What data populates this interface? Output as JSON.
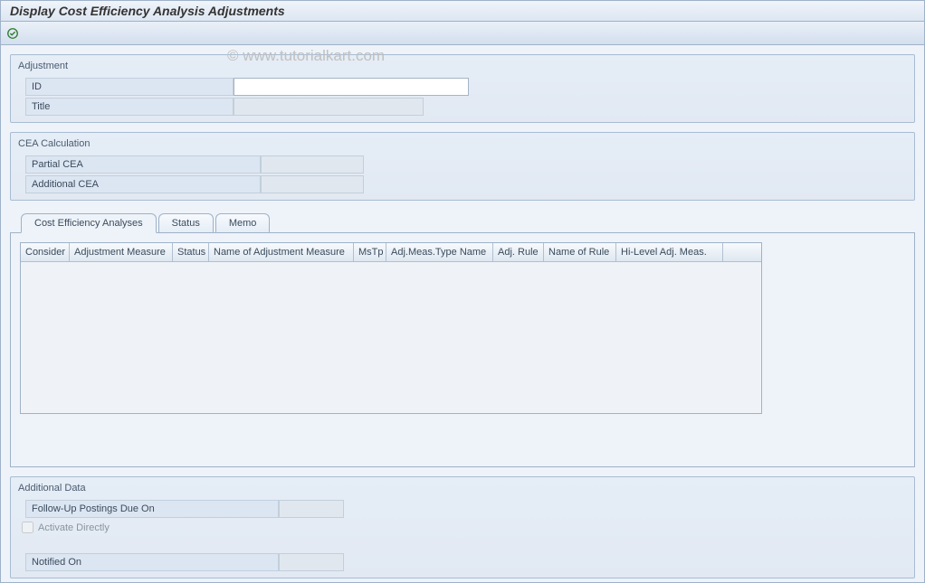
{
  "page_title": "Display Cost Efficiency Analysis Adjustments",
  "watermark": "© www.tutorialkart.com",
  "adjustment": {
    "group_label": "Adjustment",
    "id_label": "ID",
    "id_value": "",
    "title_label": "Title",
    "title_value": ""
  },
  "cea_calculation": {
    "group_label": "CEA Calculation",
    "partial_label": "Partial CEA",
    "partial_value": "",
    "additional_label": "Additional CEA",
    "additional_value": ""
  },
  "tabs": {
    "t0": "Cost Efficiency Analyses",
    "t1": "Status",
    "t2": "Memo"
  },
  "table_headers": {
    "c0": "Consider",
    "c1": "Adjustment Measure",
    "c2": "Status",
    "c3": "Name of Adjustment Measure",
    "c4": "MsTp",
    "c5": "Adj.Meas.Type Name",
    "c6": "Adj. Rule",
    "c7": "Name of Rule",
    "c8": "Hi-Level Adj. Meas."
  },
  "additional_data": {
    "group_label": "Additional Data",
    "followup_label": "Follow-Up Postings Due On",
    "followup_value": "",
    "activate_label": "Activate Directly",
    "notified_label": "Notified On",
    "notified_value": ""
  }
}
